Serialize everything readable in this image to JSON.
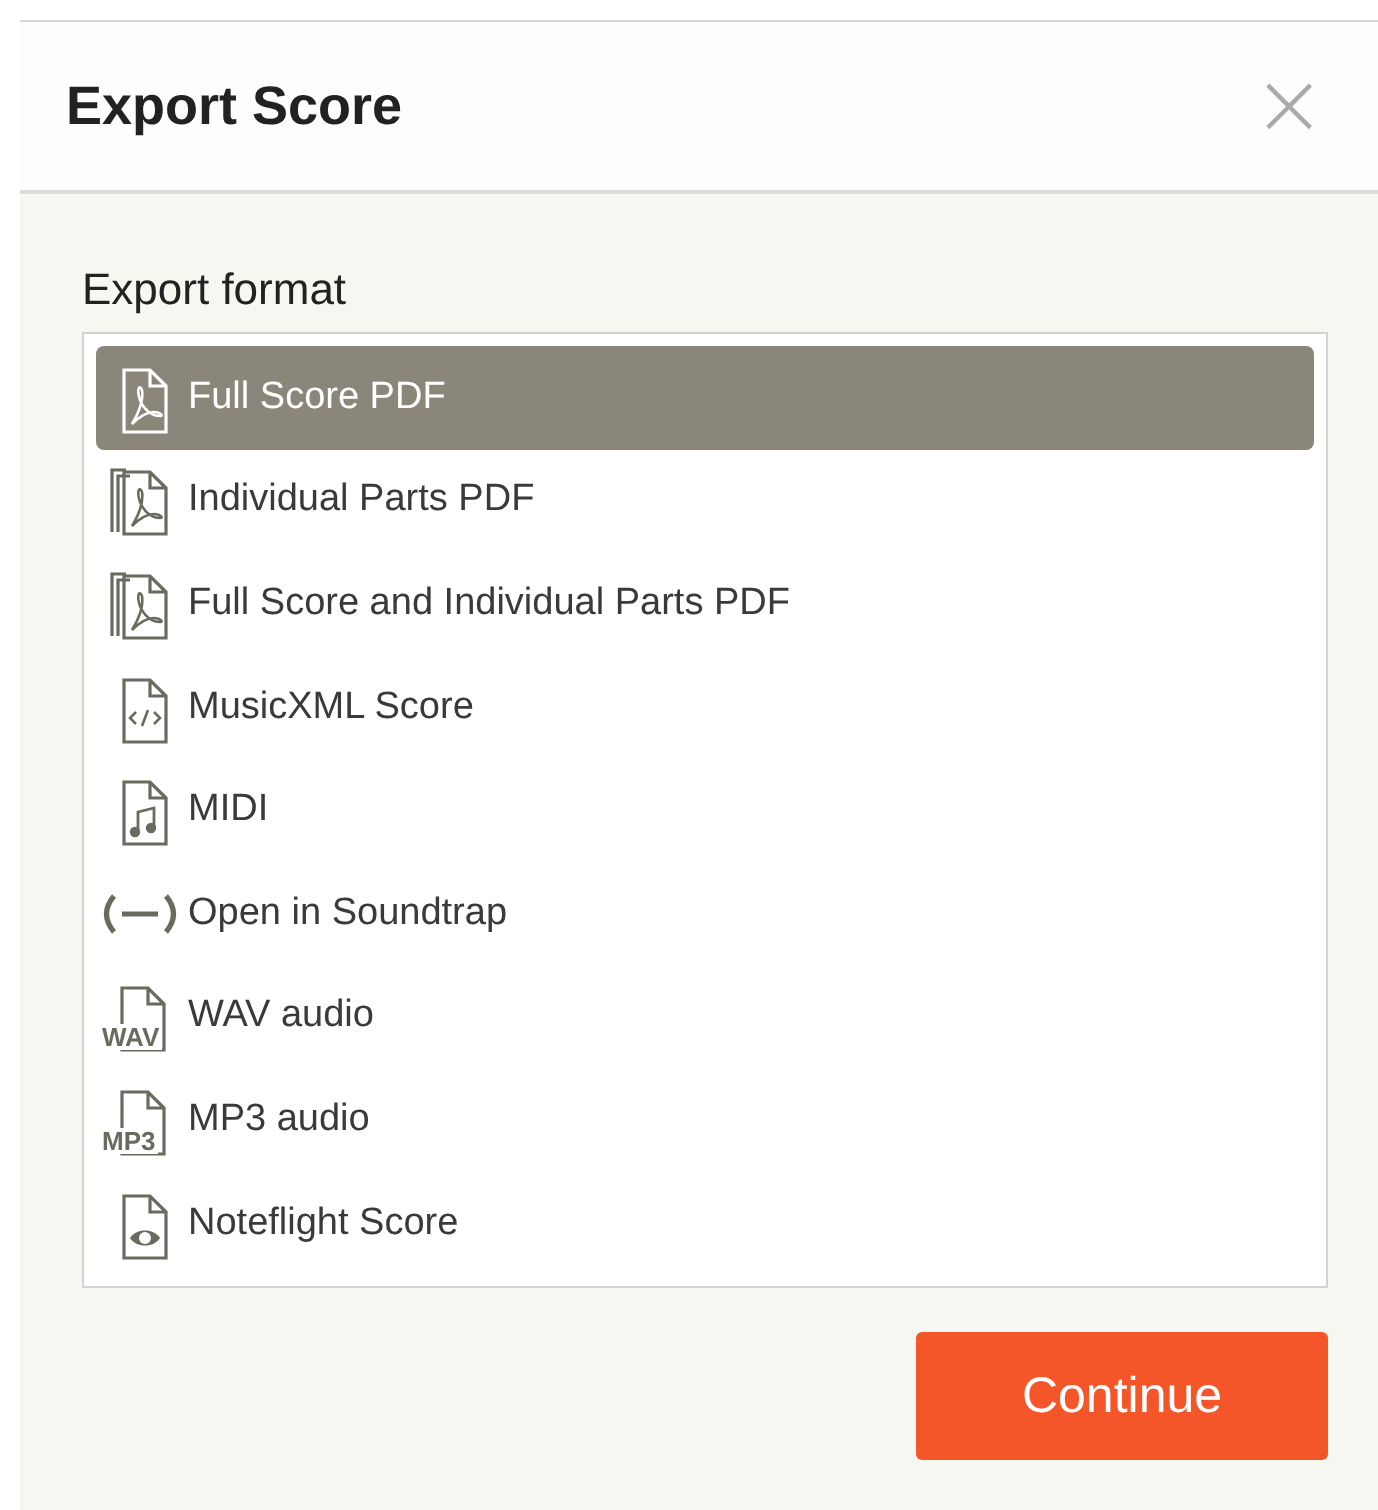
{
  "dialog": {
    "title": "Export Score",
    "close": "×"
  },
  "export_format": {
    "label": "Export format",
    "options": [
      {
        "kind": "pdf",
        "label": "Full Score PDF",
        "selected": true
      },
      {
        "kind": "pdf-multi",
        "label": "Individual Parts PDF",
        "selected": false
      },
      {
        "kind": "pdf-multi",
        "label": "Full Score and Individual Parts PDF",
        "selected": false
      },
      {
        "kind": "xml",
        "label": "MusicXML Score",
        "selected": false
      },
      {
        "kind": "midi",
        "label": "MIDI",
        "selected": false
      },
      {
        "kind": "soundtrap",
        "label": "Open in Soundtrap",
        "selected": false
      },
      {
        "kind": "audio",
        "icon_text": "WAV",
        "label": "WAV audio",
        "selected": false
      },
      {
        "kind": "audio",
        "icon_text": "MP3",
        "label": "MP3 audio",
        "selected": false
      },
      {
        "kind": "noteflight",
        "label": "Noteflight Score",
        "selected": false
      }
    ]
  },
  "buttons": {
    "continue": "Continue"
  }
}
